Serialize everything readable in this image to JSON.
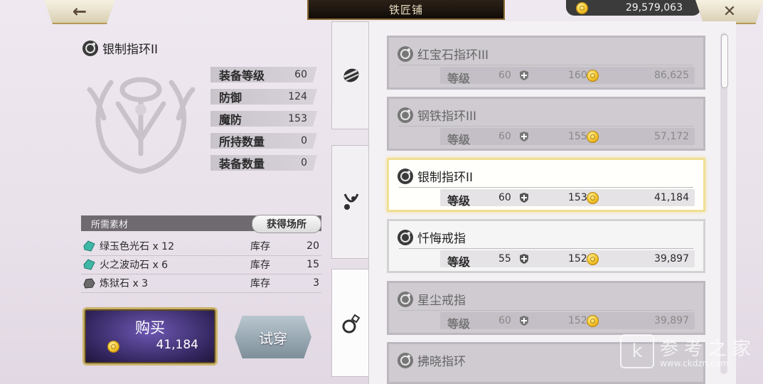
{
  "header": {
    "title": "铁匠铺",
    "gold": "29,579,063"
  },
  "detail": {
    "name": "银制指环II",
    "stats": [
      {
        "label": "装备等级",
        "value": "60"
      },
      {
        "label": "防御",
        "value": "124"
      },
      {
        "label": "魔防",
        "value": "153"
      },
      {
        "label": "所持数量",
        "value": "0"
      },
      {
        "label": "装备数量",
        "value": "0"
      }
    ],
    "materials_header": "所需素材",
    "obtain_label": "获得场所",
    "materials": [
      {
        "name": "绿玉色光石 x 12",
        "stock_label": "库存",
        "count": "20",
        "color": "#3fb7a6"
      },
      {
        "name": "火之波动石 x 6",
        "stock_label": "库存",
        "count": "15",
        "color": "#3fb7a6"
      },
      {
        "name": "炼狱石 x 3",
        "stock_label": "库存",
        "count": "3",
        "color": "#6a6a6a"
      }
    ],
    "buy_label": "购买",
    "buy_price": "41,184",
    "try_label": "试穿"
  },
  "list": [
    {
      "name": "红宝石指环III",
      "level_label": "等级",
      "level": "60",
      "def": "160",
      "price": "86,625",
      "state": "dim"
    },
    {
      "name": "钢铁指环III",
      "level_label": "等级",
      "level": "60",
      "def": "155",
      "price": "57,172",
      "state": "dim"
    },
    {
      "name": "银制指环II",
      "level_label": "等级",
      "level": "60",
      "def": "153",
      "price": "41,184",
      "state": "selected"
    },
    {
      "name": "忏悔戒指",
      "level_label": "等级",
      "level": "55",
      "def": "152",
      "price": "39,897",
      "state": "owned"
    },
    {
      "name": "星尘戒指",
      "level_label": "等级",
      "level": "60",
      "def": "152",
      "price": "39,897",
      "state": "dim"
    },
    {
      "name": "拂晓指环",
      "level_label": "",
      "level": "",
      "def": "",
      "price": "",
      "state": "dim"
    }
  ],
  "watermark": {
    "logo": "k",
    "text": "参考之家",
    "url": "www.ckdzn.com"
  }
}
